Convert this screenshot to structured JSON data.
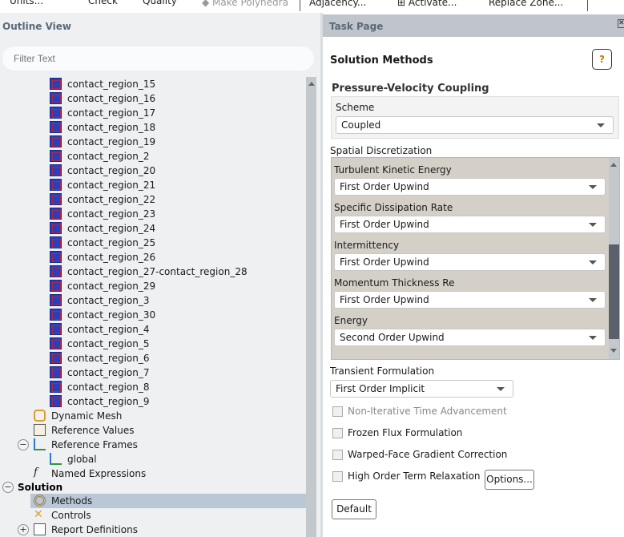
{
  "toolbar": {
    "items": [
      "Units...",
      "Check",
      "Quality",
      "Make Polyhedra",
      "Adjacency...",
      "Activate...",
      "Replace Zone..."
    ]
  },
  "outline": {
    "title": "Outline View",
    "filter_placeholder": "Filter Text",
    "regions": [
      "contact_region_15",
      "contact_region_16",
      "contact_region_17",
      "contact_region_18",
      "contact_region_19",
      "contact_region_2",
      "contact_region_20",
      "contact_region_21",
      "contact_region_22",
      "contact_region_23",
      "contact_region_24",
      "contact_region_25",
      "contact_region_26",
      "contact_region_27-contact_region_28",
      "contact_region_29",
      "contact_region_3",
      "contact_region_30",
      "contact_region_4",
      "contact_region_5",
      "contact_region_6",
      "contact_region_7",
      "contact_region_8",
      "contact_region_9"
    ],
    "setup_items": {
      "dynamic_mesh": "Dynamic Mesh",
      "reference_values": "Reference Values",
      "reference_frames": "Reference Frames",
      "global": "global",
      "named_expressions": "Named Expressions"
    },
    "solution": {
      "label": "Solution",
      "methods": "Methods",
      "controls": "Controls",
      "report_definitions": "Report Definitions"
    }
  },
  "task": {
    "title": "Task Page",
    "heading": "Solution Methods",
    "help": "?",
    "pv": {
      "label": "Pressure-Velocity Coupling",
      "scheme_label": "Scheme",
      "scheme": "Coupled"
    },
    "spatial": {
      "label": "Spatial Discretization",
      "rows": [
        {
          "label": "Turbulent Kinetic Energy",
          "value": "First Order Upwind"
        },
        {
          "label": "Specific Dissipation Rate",
          "value": "First Order Upwind"
        },
        {
          "label": "Intermittency",
          "value": "First Order Upwind"
        },
        {
          "label": "Momentum Thickness Re",
          "value": "First Order Upwind"
        },
        {
          "label": "Energy",
          "value": "Second Order Upwind"
        }
      ]
    },
    "transient": {
      "label": "Transient Formulation",
      "value": "First Order Implicit"
    },
    "checks": [
      {
        "label": "Non-Iterative Time Advancement",
        "checked": false,
        "disabled": true
      },
      {
        "label": "Frozen Flux Formulation",
        "checked": false
      },
      {
        "label": "Warped-Face Gradient Correction",
        "checked": false
      },
      {
        "label": "High Order Term Relaxation",
        "checked": false
      }
    ],
    "options_label": "Options...",
    "default_label": "Default"
  }
}
